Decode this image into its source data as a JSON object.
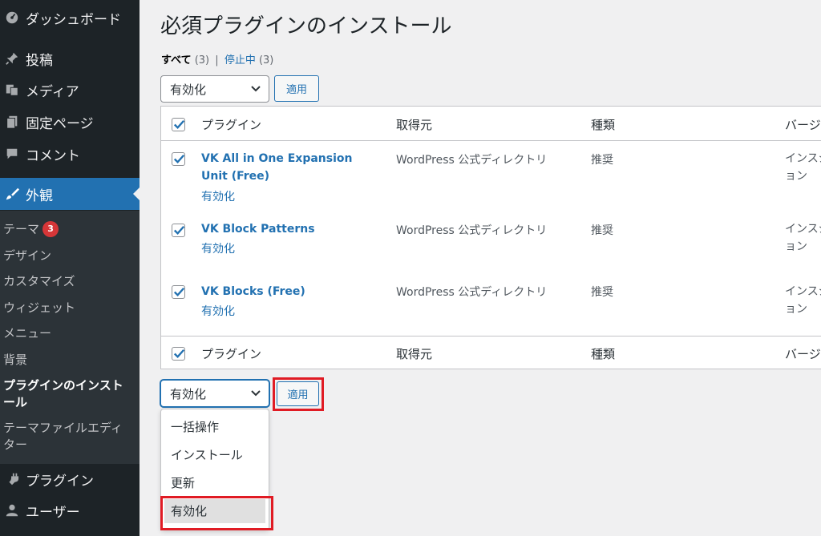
{
  "sidebar": {
    "items": [
      {
        "label": "ダッシュボード",
        "icon": "dashboard-icon"
      },
      {
        "label": "投稿",
        "icon": "pin-icon"
      },
      {
        "label": "メディア",
        "icon": "media-icon"
      },
      {
        "label": "固定ページ",
        "icon": "page-icon"
      },
      {
        "label": "コメント",
        "icon": "comment-icon"
      },
      {
        "label": "外観",
        "icon": "brush-icon"
      },
      {
        "label": "プラグイン",
        "icon": "plugin-icon"
      },
      {
        "label": "ユーザー",
        "icon": "user-icon"
      }
    ],
    "submenu": {
      "theme": "テーマ",
      "theme_badge": "3",
      "design": "デザイン",
      "customize": "カスタマイズ",
      "widgets": "ウィジェット",
      "menus": "メニュー",
      "background": "背景",
      "install_plugins": "プラグインのインストール",
      "theme_editor": "テーマファイルエディター"
    }
  },
  "main": {
    "title": "必須プラグインのインストール",
    "filters": {
      "all_label": "すべて",
      "all_count": "(3)",
      "separator": "|",
      "inactive_label": "停止中",
      "inactive_count": "(3)"
    },
    "bulk_action_value": "有効化",
    "apply_label": "適用",
    "table": {
      "headers": {
        "plugin": "プラグイン",
        "source": "取得元",
        "type": "種類",
        "version": "バージ"
      },
      "rows": [
        {
          "name": "VK All in One Expansion Unit (Free)",
          "action": "有効化",
          "source": "WordPress 公式ディレクトリ",
          "type": "推奨",
          "version": "インスジョン"
        },
        {
          "name": "VK Block Patterns",
          "action": "有効化",
          "source": "WordPress 公式ディレクトリ",
          "type": "推奨",
          "version": "インスジョン"
        },
        {
          "name": "VK Blocks (Free)",
          "action": "有効化",
          "source": "WordPress 公式ディレクトリ",
          "type": "推奨",
          "version": "インスジョン"
        }
      ]
    },
    "dropdown_options": [
      "一括操作",
      "インストール",
      "更新",
      "有効化"
    ]
  },
  "colors": {
    "accent": "#2271b1",
    "sidebar_bg": "#1d2327",
    "highlight": "#e01b24",
    "badge": "#d63638"
  }
}
